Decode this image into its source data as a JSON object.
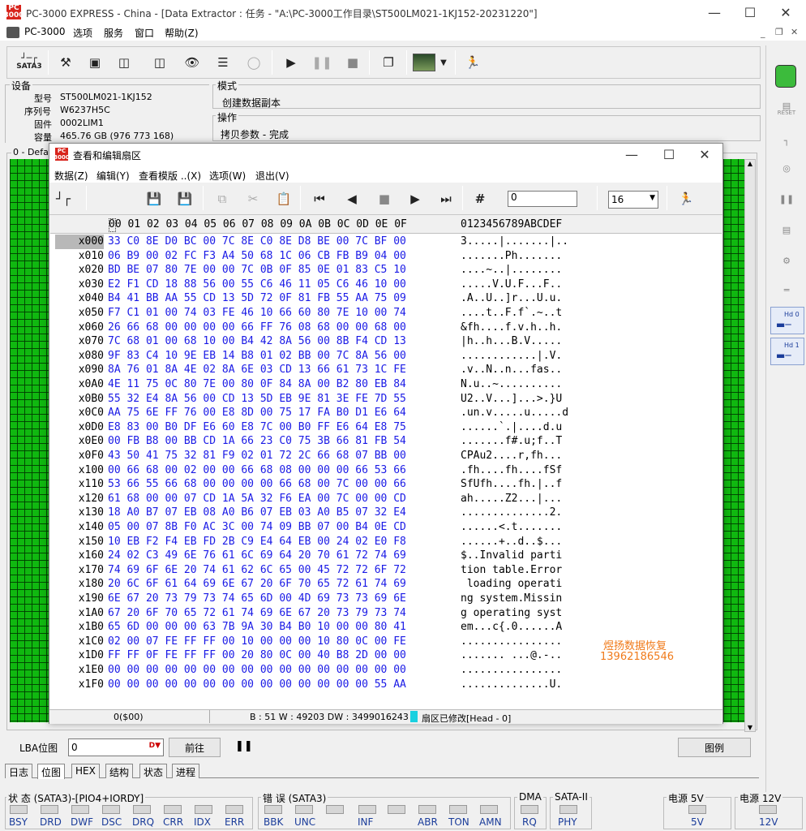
{
  "window": {
    "title": "PC-3000 EXPRESS - China - [Data Extractor : 任务 - \"A:\\PC-3000工作目录\\ST500LM021-1KJ152-20231220\"]",
    "logo_text": "PC 3000"
  },
  "menu": [
    "PC-3000",
    "选项",
    "服务",
    "窗口",
    "帮助(Z)"
  ],
  "toolbar": {
    "sata_label": "SATA3"
  },
  "device": {
    "group_title": "设备",
    "model_label": "型号",
    "model": "ST500LM021-1KJ152",
    "serial_label": "序列号",
    "serial": "W6237H5C",
    "firmware_label": "固件",
    "firmware": "0002LIM1",
    "capacity_label": "容量",
    "capacity": "465.76 GB (976 773 168)"
  },
  "mode": {
    "group_title": "模式",
    "value": "创建数据副本"
  },
  "operation": {
    "group_title": "操作",
    "value": "拷贝参数 - 完成"
  },
  "bitmap_panel_title": "0 - Defau",
  "dialog": {
    "title": "查看和编辑扇区",
    "menu": [
      "数据(Z)",
      "编辑(Y)",
      "查看模版 ..(X)",
      "选项(W)",
      "退出(V)"
    ],
    "search_value": "0",
    "columns_value": "16",
    "header_hex": "00 01 02 03 04 05 06 07 08 09 0A 0B 0C 0D 0E 0F",
    "header_ascii": "0123456789ABCDEF",
    "rows": [
      {
        "o": "x000",
        "h": "33 C0 8E D0 BC 00 7C 8E C0 8E D8 BE 00 7C BF 00",
        "a": "3.....|.......|.."
      },
      {
        "o": "x010",
        "h": "06 B9 00 02 FC F3 A4 50 68 1C 06 CB FB B9 04 00",
        "a": ".......Ph......."
      },
      {
        "o": "x020",
        "h": "BD BE 07 80 7E 00 00 7C 0B 0F 85 0E 01 83 C5 10",
        "a": "....~..|........"
      },
      {
        "o": "x030",
        "h": "E2 F1 CD 18 88 56 00 55 C6 46 11 05 C6 46 10 00",
        "a": ".....V.U.F...F.."
      },
      {
        "o": "x040",
        "h": "B4 41 BB AA 55 CD 13 5D 72 0F 81 FB 55 AA 75 09",
        "a": ".A..U..]r...U.u."
      },
      {
        "o": "x050",
        "h": "F7 C1 01 00 74 03 FE 46 10 66 60 80 7E 10 00 74",
        "a": "....t..F.f`.~..t"
      },
      {
        "o": "x060",
        "h": "26 66 68 00 00 00 00 66 FF 76 08 68 00 00 68 00",
        "a": "&fh....f.v.h..h."
      },
      {
        "o": "x070",
        "h": "7C 68 01 00 68 10 00 B4 42 8A 56 00 8B F4 CD 13",
        "a": "|h..h...B.V....."
      },
      {
        "o": "x080",
        "h": "9F 83 C4 10 9E EB 14 B8 01 02 BB 00 7C 8A 56 00",
        "a": "............|.V."
      },
      {
        "o": "x090",
        "h": "8A 76 01 8A 4E 02 8A 6E 03 CD 13 66 61 73 1C FE",
        "a": ".v..N..n...fas.."
      },
      {
        "o": "x0A0",
        "h": "4E 11 75 0C 80 7E 00 80 0F 84 8A 00 B2 80 EB 84",
        "a": "N.u..~.........."
      },
      {
        "o": "x0B0",
        "h": "55 32 E4 8A 56 00 CD 13 5D EB 9E 81 3E FE 7D 55",
        "a": "U2..V...]...>.}U"
      },
      {
        "o": "x0C0",
        "h": "AA 75 6E FF 76 00 E8 8D 00 75 17 FA B0 D1 E6 64",
        "a": ".un.v.....u.....d"
      },
      {
        "o": "x0D0",
        "h": "E8 83 00 B0 DF E6 60 E8 7C 00 B0 FF E6 64 E8 75",
        "a": "......`.|....d.u"
      },
      {
        "o": "x0E0",
        "h": "00 FB B8 00 BB CD 1A 66 23 C0 75 3B 66 81 FB 54",
        "a": ".......f#.u;f..T"
      },
      {
        "o": "x0F0",
        "h": "43 50 41 75 32 81 F9 02 01 72 2C 66 68 07 BB 00",
        "a": "CPAu2....r,fh..."
      },
      {
        "o": "x100",
        "h": "00 66 68 00 02 00 00 66 68 08 00 00 00 66 53 66",
        "a": ".fh....fh....fSf"
      },
      {
        "o": "x110",
        "h": "53 66 55 66 68 00 00 00 00 66 68 00 7C 00 00 66",
        "a": "SfUfh....fh.|..f"
      },
      {
        "o": "x120",
        "h": "61 68 00 00 07 CD 1A 5A 32 F6 EA 00 7C 00 00 CD",
        "a": "ah.....Z2...|..."
      },
      {
        "o": "x130",
        "h": "18 A0 B7 07 EB 08 A0 B6 07 EB 03 A0 B5 07 32 E4",
        "a": "..............2."
      },
      {
        "o": "x140",
        "h": "05 00 07 8B F0 AC 3C 00 74 09 BB 07 00 B4 0E CD",
        "a": "......<.t......."
      },
      {
        "o": "x150",
        "h": "10 EB F2 F4 EB FD 2B C9 E4 64 EB 00 24 02 E0 F8",
        "a": "......+..d..$..."
      },
      {
        "o": "x160",
        "h": "24 02 C3 49 6E 76 61 6C 69 64 20 70 61 72 74 69",
        "a": "$..Invalid parti"
      },
      {
        "o": "x170",
        "h": "74 69 6F 6E 20 74 61 62 6C 65 00 45 72 72 6F 72",
        "a": "tion table.Error"
      },
      {
        "o": "x180",
        "h": "20 6C 6F 61 64 69 6E 67 20 6F 70 65 72 61 74 69",
        "a": " loading operati"
      },
      {
        "o": "x190",
        "h": "6E 67 20 73 79 73 74 65 6D 00 4D 69 73 73 69 6E",
        "a": "ng system.Missin"
      },
      {
        "o": "x1A0",
        "h": "67 20 6F 70 65 72 61 74 69 6E 67 20 73 79 73 74",
        "a": "g operating syst"
      },
      {
        "o": "x1B0",
        "h": "65 6D 00 00 00 63 7B 9A 30 B4 B0 10 00 00 80 41",
        "a": "em...c{.0......A"
      },
      {
        "o": "x1C0",
        "h": "02 00 07 FE FF FF 00 10 00 00 00 10 80 0C 00 FE",
        "a": "................"
      },
      {
        "o": "x1D0",
        "h": "FF FF 0F FE FF FF 00 20 80 0C 00 40 B8 2D 00 00",
        "a": "....... ...@.-.."
      },
      {
        "o": "x1E0",
        "h": "00 00 00 00 00 00 00 00 00 00 00 00 00 00 00 00",
        "a": "................"
      },
      {
        "o": "x1F0",
        "h": "00 00 00 00 00 00 00 00 00 00 00 00 00 00 55 AA",
        "a": "..............U."
      }
    ],
    "status_offset": "0($00)",
    "status_info": "B : 51 W : 49203 DW : 3499016243",
    "status_modified": "扇区已修改[Head - 0]",
    "watermark_line1": "煜扬数据恢复",
    "watermark_line2": "13962186546"
  },
  "lba": {
    "label": "LBA位图",
    "value": "0",
    "goto_button": "前往",
    "legend_button": "图例"
  },
  "bottom_tabs": [
    "日志",
    "位图",
    "HEX",
    "结构",
    "状态",
    "进程"
  ],
  "status_groups": {
    "state_title": "状 态 (SATA3)-[PIO4+IORDY]",
    "state_leds": [
      "BSY",
      "DRD",
      "DWF",
      "DSC",
      "DRQ",
      "CRR",
      "IDX",
      "ERR"
    ],
    "error_title": "错 误 (SATA3)",
    "error_leds": [
      "BBK",
      "UNC",
      "INF",
      "ABR",
      "TON",
      "AMN"
    ],
    "dma_title": "DMA",
    "dma_led": "RQ",
    "sata_title": "SATA-II",
    "sata_led": "PHY",
    "power5_title": "电源 5V",
    "power5_led": "5V",
    "power12_title": "电源 12V",
    "power12_led": "12V"
  },
  "right_panel": {
    "reset_label": "RESET",
    "hd0_label": "Hd 0",
    "hd1_label": "Hd 1"
  },
  "colors": {
    "hex_blue": "#1a1ae6",
    "bitmap_green": "#10b810",
    "led_gray": "#d6d6d6",
    "logo_red": "#d8241c",
    "watermark_orange": "#f07a1a"
  }
}
